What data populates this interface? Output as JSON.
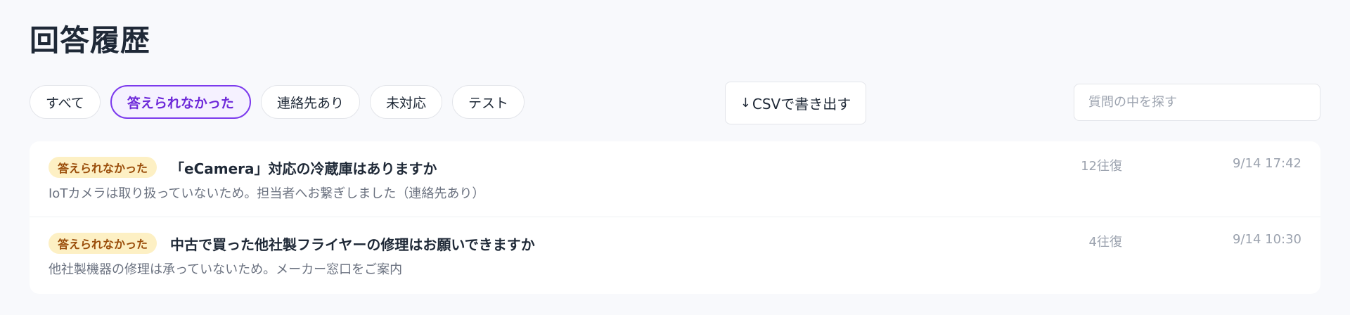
{
  "page": {
    "title": "回答履歴"
  },
  "filters": [
    {
      "label": "すべて",
      "active": false
    },
    {
      "label": "答えられなかった",
      "active": true
    },
    {
      "label": "連絡先あり",
      "active": false
    },
    {
      "label": "未対応",
      "active": false
    },
    {
      "label": "テスト",
      "active": false
    }
  ],
  "toolbar": {
    "csv_arrow": "↓",
    "csv_label": "CSVで書き出す"
  },
  "search": {
    "placeholder": "質問の中を探す",
    "value": ""
  },
  "rows": [
    {
      "badge": "答えられなかった",
      "question": "「eCamera」対応の冷蔵庫はありますか",
      "answer": "IoTカメラは取り扱っていないため。担当者へお繋ぎしました（連絡先あり）",
      "turns": "12往復",
      "timestamp": "9/14 17:42"
    },
    {
      "badge": "答えられなかった",
      "question": "中古で買った他社製フライヤーの修理はお願いできますか",
      "answer": "他社製機器の修理は承っていないため。メーカー窓口をご案内",
      "turns": "4往復",
      "timestamp": "9/14 10:30"
    }
  ],
  "colors": {
    "accent": "#7c3aed",
    "badge_bg": "#fdf0c4",
    "badge_text": "#9a4d0a"
  }
}
